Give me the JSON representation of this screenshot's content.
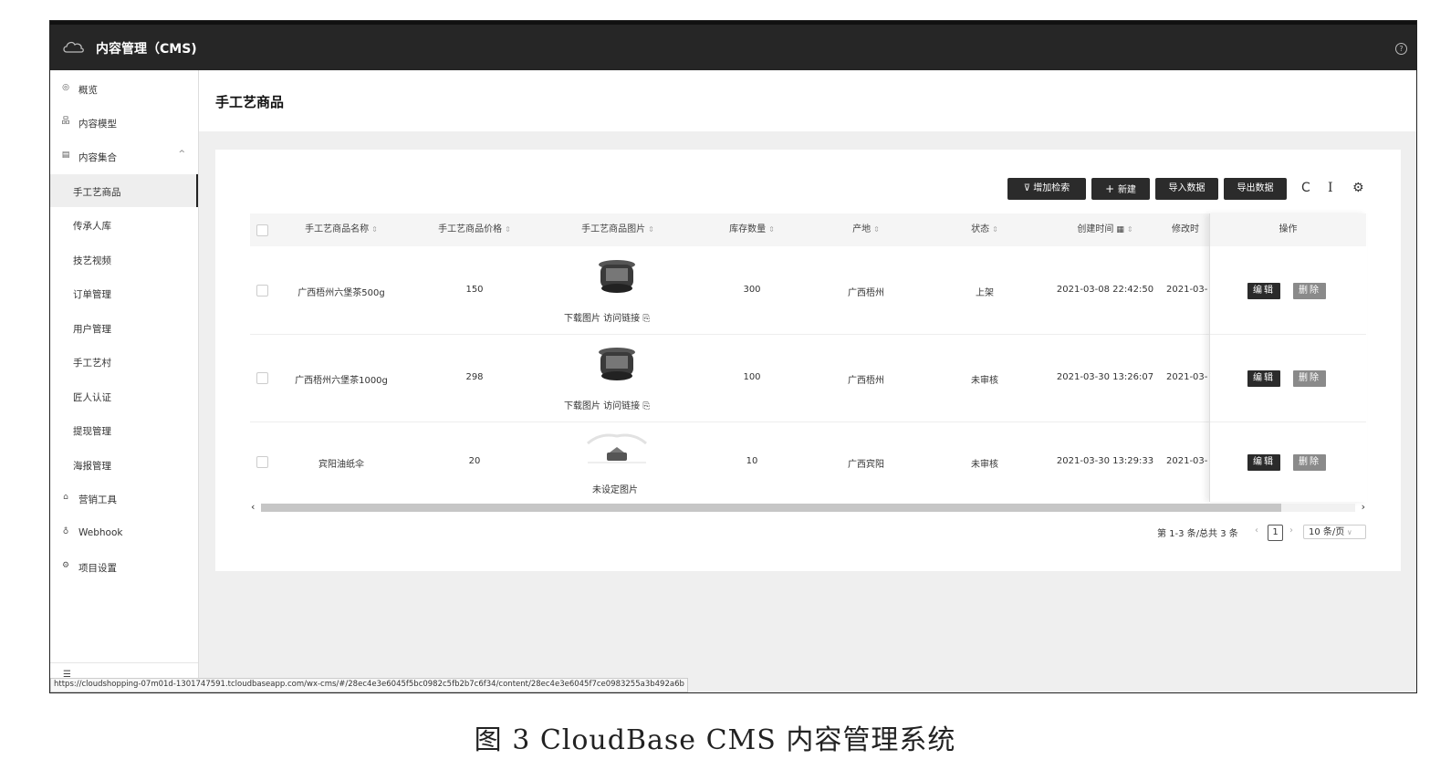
{
  "app": {
    "title": "内容管理（CMS)"
  },
  "sidebar": {
    "items": [
      {
        "label": "概览",
        "icon": "eye-icon"
      },
      {
        "label": "内容模型",
        "icon": "model-icon"
      },
      {
        "label": "内容集合",
        "icon": "collection-icon"
      },
      {
        "label": "手工艺商品"
      },
      {
        "label": "传承人库"
      },
      {
        "label": "技艺视频"
      },
      {
        "label": "订单管理"
      },
      {
        "label": "用户管理"
      },
      {
        "label": "手工艺村"
      },
      {
        "label": "匠人认证"
      },
      {
        "label": "提现管理"
      },
      {
        "label": "海报管理"
      },
      {
        "label": "营销工具",
        "icon": "bag-icon"
      },
      {
        "label": "Webhook",
        "icon": "webhook-icon"
      },
      {
        "label": "项目设置",
        "icon": "gear-icon"
      }
    ]
  },
  "page": {
    "title": "手工艺商品"
  },
  "toolbar": {
    "filter": "增加检索",
    "new": "新建",
    "import": "导入数据",
    "export": "导出数据",
    "refresh_icon": "C",
    "text_icon": "I",
    "settings_icon": "⚙"
  },
  "table": {
    "columns": [
      "手工艺商品名称",
      "手工艺商品价格",
      "手工艺商品图片",
      "库存数量",
      "产地",
      "状态",
      "创建时间",
      "修改时",
      "操作"
    ],
    "rows": [
      {
        "name": "广西梧州六堡茶500g",
        "price": "150",
        "image_links": "下载图片   访问链接",
        "stock": "300",
        "origin": "广西梧州",
        "status": "上架",
        "created": "2021-03-08 22:42:50",
        "modified": "2021-03-"
      },
      {
        "name": "广西梧州六堡茶1000g",
        "price": "298",
        "image_links": "下载图片   访问链接",
        "stock": "100",
        "origin": "广西梧州",
        "status": "未审核",
        "created": "2021-03-30 13:26:07",
        "modified": "2021-03-"
      },
      {
        "name": "宾阳油纸伞",
        "price": "20",
        "image_links": "未设定图片",
        "stock": "10",
        "origin": "广西宾阳",
        "status": "未审核",
        "created": "2021-03-30 13:29:33",
        "modified": "2021-03-"
      }
    ],
    "actions": {
      "edit": "编辑",
      "delete": "删除"
    }
  },
  "pagination": {
    "summary": "第 1-3 条/总共 3 条",
    "current": "1",
    "page_size": "10 条/页"
  },
  "status_url": "https://cloudshopping-07m01d-1301747591.tcloudbaseapp.com/wx-cms/#/28ec4e3e6045f5bc0982c5fb2b7c6f34/content/28ec4e3e6045f7ce0983255a3b492a6b",
  "caption": "图 3   CloudBase  CMS 内容管理系统"
}
